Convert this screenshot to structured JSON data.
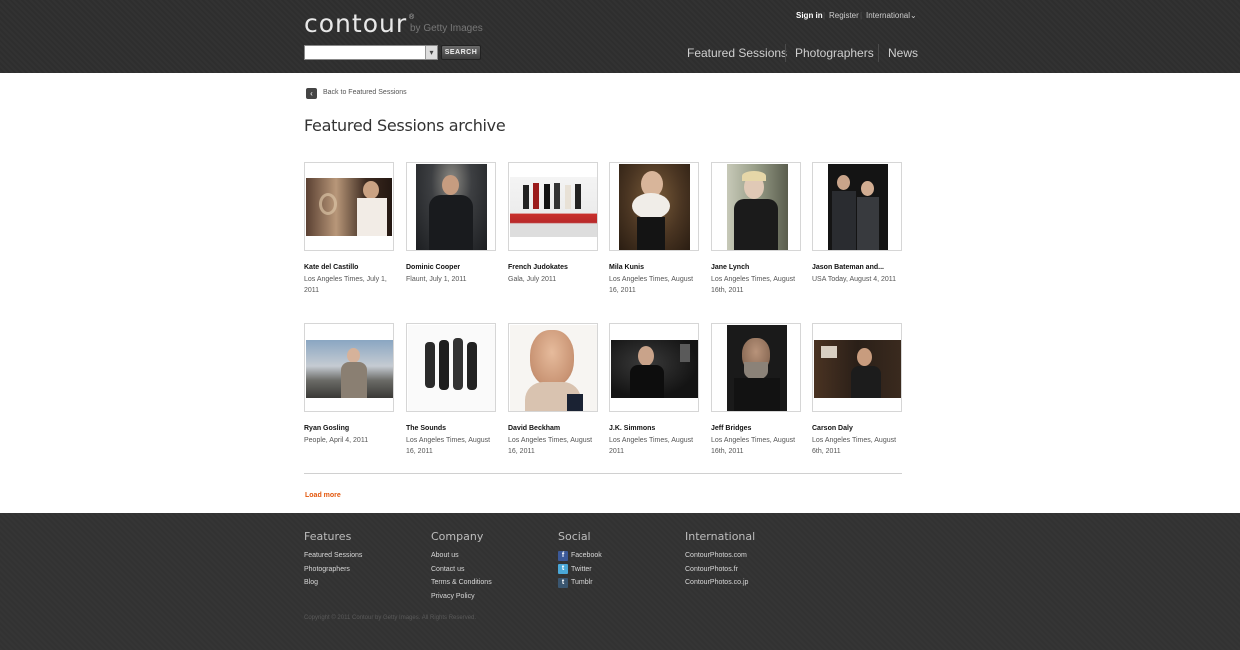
{
  "header": {
    "logo_text": "contour",
    "logo_reg": "®",
    "logo_sub": "by Getty Images",
    "search_button": "SEARCH",
    "search_placeholder": "",
    "top_links": [
      "Sign in",
      "Register",
      "International"
    ],
    "nav": [
      "Featured Sessions",
      "Photographers",
      "News"
    ]
  },
  "content": {
    "back_link": "Back to Featured Sessions",
    "title": "Featured Sessions archive",
    "sessions": [
      {
        "name": "Kate del Castillo",
        "sub": "Los Angeles Times, July 1, 2011"
      },
      {
        "name": "Dominic Cooper",
        "sub": "Flaunt, July 1, 2011"
      },
      {
        "name": "French Judokates",
        "sub": "Gala, July 2011"
      },
      {
        "name": "Mila Kunis",
        "sub": "Los Angeles Times, August 16, 2011"
      },
      {
        "name": "Jane Lynch",
        "sub": "Los Angeles Times, August 16th, 2011"
      },
      {
        "name": "Jason Bateman and...",
        "sub": "USA Today, August 4, 2011"
      },
      {
        "name": "Ryan Gosling",
        "sub": "People, April 4, 2011"
      },
      {
        "name": "The Sounds",
        "sub": "Los Angeles Times, August 16, 2011"
      },
      {
        "name": "David Beckham",
        "sub": "Los Angeles Times, August 16, 2011"
      },
      {
        "name": "J.K. Simmons",
        "sub": "Los Angeles Times, August 2011"
      },
      {
        "name": "Jeff Bridges",
        "sub": "Los Angeles Times, August 16th, 2011"
      },
      {
        "name": "Carson Daly",
        "sub": "Los Angeles Times, August 6th, 2011"
      }
    ],
    "load_more": "Load more"
  },
  "footer": {
    "features": {
      "title": "Features",
      "links": [
        "Featured Sessions",
        "Photographers",
        "Blog"
      ]
    },
    "company": {
      "title": "Company",
      "links": [
        "About us",
        "Contact us",
        "Terms & Conditions",
        "Privacy Policy"
      ]
    },
    "social": {
      "title": "Social",
      "links": [
        "Facebook",
        "Twitter",
        "Tumblr"
      ]
    },
    "international": {
      "title": "International",
      "links": [
        "ContourPhotos.com",
        "ContourPhotos.fr",
        "ContourPhotos.co.jp"
      ]
    },
    "copyright": "Copyright © 2011 Contour by Getty Images. All Rights Reserved."
  },
  "colors": {
    "header_bg": "#2f2f2f",
    "footer_bg": "#333333",
    "accent": "#e3560b"
  }
}
